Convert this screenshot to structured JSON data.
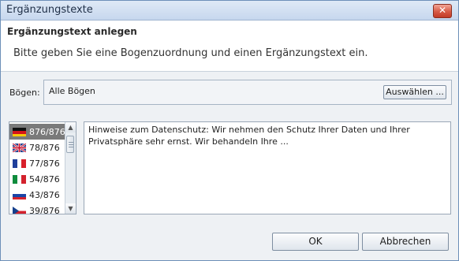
{
  "window": {
    "title": "Ergänzungstexte",
    "close_glyph": "✕"
  },
  "header": {
    "title": "Ergänzungstext anlegen",
    "subtitle": "Bitte geben Sie eine Bogenzuordnung und einen Ergänzungstext ein."
  },
  "bogen": {
    "label": "Bögen:",
    "value": "Alle Bögen",
    "select_button": "Auswählen ..."
  },
  "languages": [
    {
      "text": "876/876",
      "flag": "germany-flag-icon",
      "selected": true
    },
    {
      "text": "78/876",
      "flag": "uk-flag-icon",
      "selected": false
    },
    {
      "text": "77/876",
      "flag": "france-flag-icon",
      "selected": false
    },
    {
      "text": "54/876",
      "flag": "italy-flag-icon",
      "selected": false
    },
    {
      "text": "43/876",
      "flag": "russia-flag-icon",
      "selected": false
    },
    {
      "text": "39/876",
      "flag": "czech-flag-icon",
      "selected": false
    }
  ],
  "text_content": "Hinweise zum Datenschutz: Wir nehmen den Schutz Ihrer Daten und Ihrer Privatsphäre sehr ernst. Wir behandeln Ihre ...",
  "buttons": {
    "ok": "OK",
    "cancel": "Abbrechen"
  },
  "scroll_arrows": {
    "up": "▲",
    "down": "▼"
  }
}
